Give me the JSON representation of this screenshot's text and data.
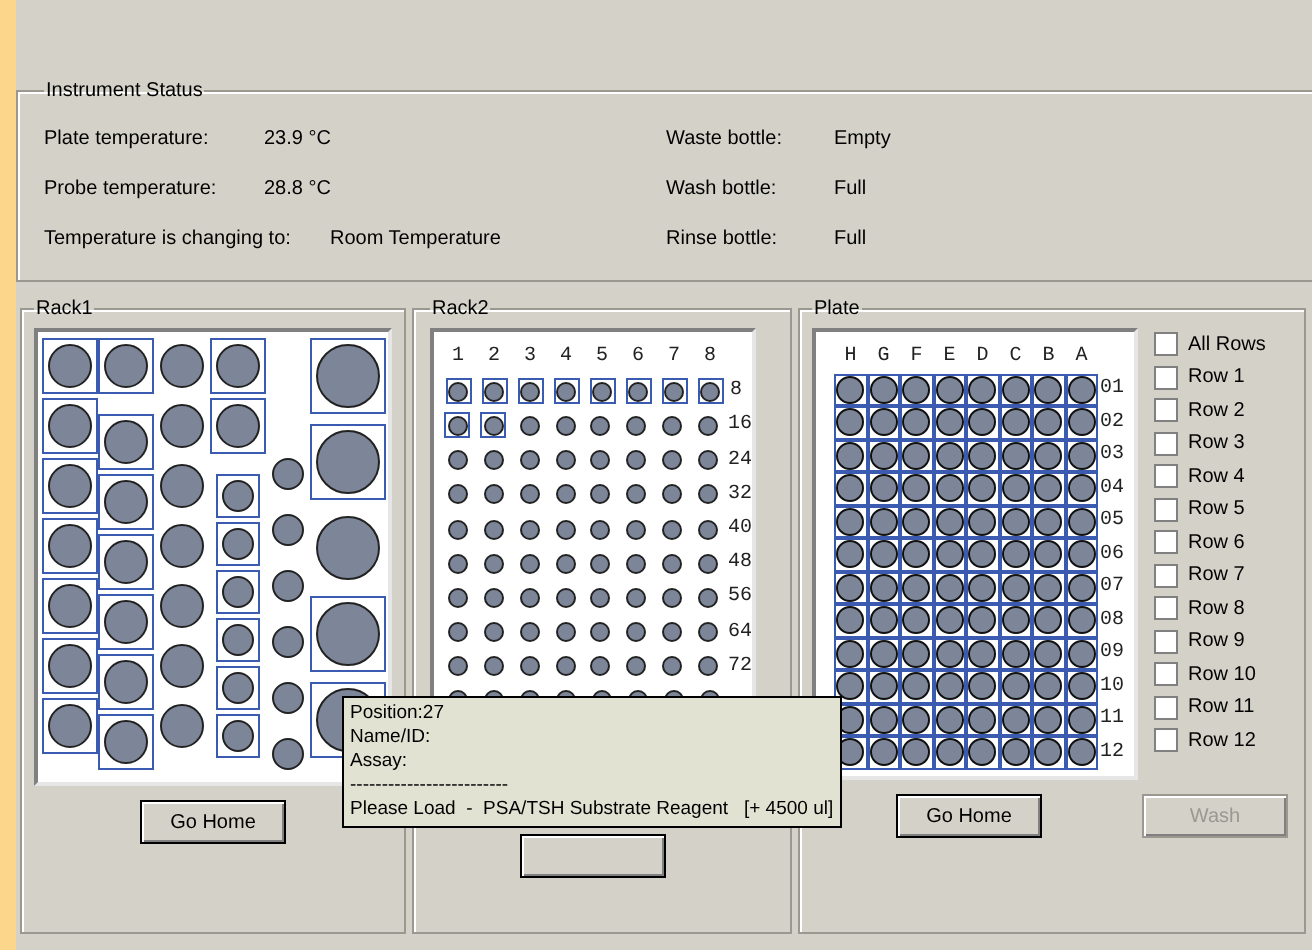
{
  "instrument_status": {
    "title": "Instrument Status",
    "left": [
      {
        "label": "Plate temperature:",
        "value": "23.9 °C"
      },
      {
        "label": "Probe temperature:",
        "value": "28.8 °C"
      },
      {
        "label": "Temperature is changing to:",
        "value": "Room Temperature"
      }
    ],
    "right": [
      {
        "label": "Waste bottle:",
        "value": "Empty"
      },
      {
        "label": "Wash bottle:",
        "value": "Full"
      },
      {
        "label": "Rinse bottle:",
        "value": "Full"
      }
    ]
  },
  "rack1": {
    "title": "Rack1",
    "button": "Go Home",
    "columns": [
      {
        "kind": "medium",
        "tubes": [
          true,
          true,
          true,
          true,
          true,
          true,
          true
        ]
      },
      {
        "kind": "staggered",
        "tubes": [
          true,
          true,
          true,
          true,
          true,
          true,
          true
        ]
      },
      {
        "kind": "medium",
        "tubes": [
          false,
          false,
          false,
          false,
          false,
          false,
          false
        ]
      },
      {
        "kind": "mixed",
        "tubes": [
          true,
          true,
          true,
          true,
          true,
          true,
          true,
          true
        ]
      },
      {
        "kind": "small",
        "tubes": [
          false,
          false,
          false,
          false,
          false,
          false
        ]
      },
      {
        "kind": "large",
        "tubes": [
          true,
          true,
          false,
          true,
          true
        ]
      }
    ]
  },
  "rack2": {
    "title": "Rack2",
    "columns": [
      "1",
      "2",
      "3",
      "4",
      "5",
      "6",
      "7",
      "8"
    ],
    "rows": [
      {
        "label": "8",
        "selected": [
          true,
          true,
          true,
          true,
          true,
          true,
          true,
          true
        ]
      },
      {
        "label": "16",
        "selected": [
          true,
          true,
          false,
          false,
          false,
          false,
          false,
          false
        ]
      },
      {
        "label": "24",
        "selected": [
          false,
          false,
          false,
          false,
          false,
          false,
          false,
          false
        ]
      },
      {
        "label": "32",
        "selected": [
          false,
          false,
          false,
          false,
          false,
          false,
          false,
          false
        ]
      },
      {
        "label": "40",
        "selected": [
          false,
          false,
          false,
          false,
          false,
          false,
          false,
          false
        ]
      },
      {
        "label": "48",
        "selected": [
          false,
          false,
          false,
          false,
          false,
          false,
          false,
          false
        ]
      },
      {
        "label": "56",
        "selected": [
          false,
          false,
          false,
          false,
          false,
          false,
          false,
          false
        ]
      },
      {
        "label": "64",
        "selected": [
          false,
          false,
          false,
          false,
          false,
          false,
          false,
          false
        ]
      },
      {
        "label": "72",
        "selected": [
          false,
          false,
          false,
          false,
          false,
          false,
          false,
          false
        ]
      }
    ]
  },
  "plate": {
    "title": "Plate",
    "columns": [
      "H",
      "G",
      "F",
      "E",
      "D",
      "C",
      "B",
      "A"
    ],
    "rows": [
      {
        "label": "01",
        "selected": [
          true,
          true,
          true,
          true,
          true,
          true,
          true,
          true
        ]
      },
      {
        "label": "02",
        "selected": [
          true,
          true,
          true,
          true,
          true,
          true,
          true,
          true
        ]
      },
      {
        "label": "03",
        "selected": [
          true,
          true,
          true,
          true,
          true,
          true,
          true,
          true
        ]
      },
      {
        "label": "04",
        "selected": [
          true,
          true,
          true,
          true,
          true,
          true,
          true,
          true
        ]
      },
      {
        "label": "05",
        "selected": [
          true,
          true,
          true,
          true,
          true,
          true,
          true,
          true
        ]
      },
      {
        "label": "06",
        "selected": [
          true,
          true,
          true,
          true,
          true,
          true,
          true,
          true
        ]
      },
      {
        "label": "07",
        "selected": [
          true,
          true,
          true,
          true,
          true,
          true,
          true,
          true
        ]
      },
      {
        "label": "08",
        "selected": [
          true,
          true,
          true,
          true,
          true,
          true,
          true,
          true
        ]
      },
      {
        "label": "09",
        "selected": [
          true,
          true,
          true,
          true,
          true,
          true,
          true,
          true
        ]
      },
      {
        "label": "10",
        "selected": [
          true,
          true,
          true,
          true,
          true,
          true,
          true,
          true
        ]
      },
      {
        "label": "11",
        "selected": [
          true,
          true,
          true,
          true,
          true,
          true,
          true,
          true
        ]
      },
      {
        "label": "12",
        "selected": [
          true,
          true,
          true,
          true,
          true,
          true,
          true,
          true
        ]
      }
    ],
    "checkboxes": [
      {
        "label": "All Rows",
        "checked": false
      },
      {
        "label": "Row 1",
        "checked": false
      },
      {
        "label": "Row 2",
        "checked": false
      },
      {
        "label": "Row 3",
        "checked": false
      },
      {
        "label": "Row 4",
        "checked": false
      },
      {
        "label": "Row 5",
        "checked": false
      },
      {
        "label": "Row 6",
        "checked": false
      },
      {
        "label": "Row 7",
        "checked": false
      },
      {
        "label": "Row 8",
        "checked": false
      },
      {
        "label": "Row 9",
        "checked": false
      },
      {
        "label": "Row 10",
        "checked": false
      },
      {
        "label": "Row 11",
        "checked": false
      },
      {
        "label": "Row 12",
        "checked": false
      }
    ],
    "buttons": [
      {
        "label": "Go Home",
        "disabled": false
      },
      {
        "label": "Wash",
        "disabled": true
      }
    ]
  },
  "tooltip": [
    "Position:27",
    "Name/ID:",
    "Assay:",
    "-------------------------",
    "Please Load  -  PSA/TSH Substrate Reagent   [+ 4500 ul]"
  ]
}
